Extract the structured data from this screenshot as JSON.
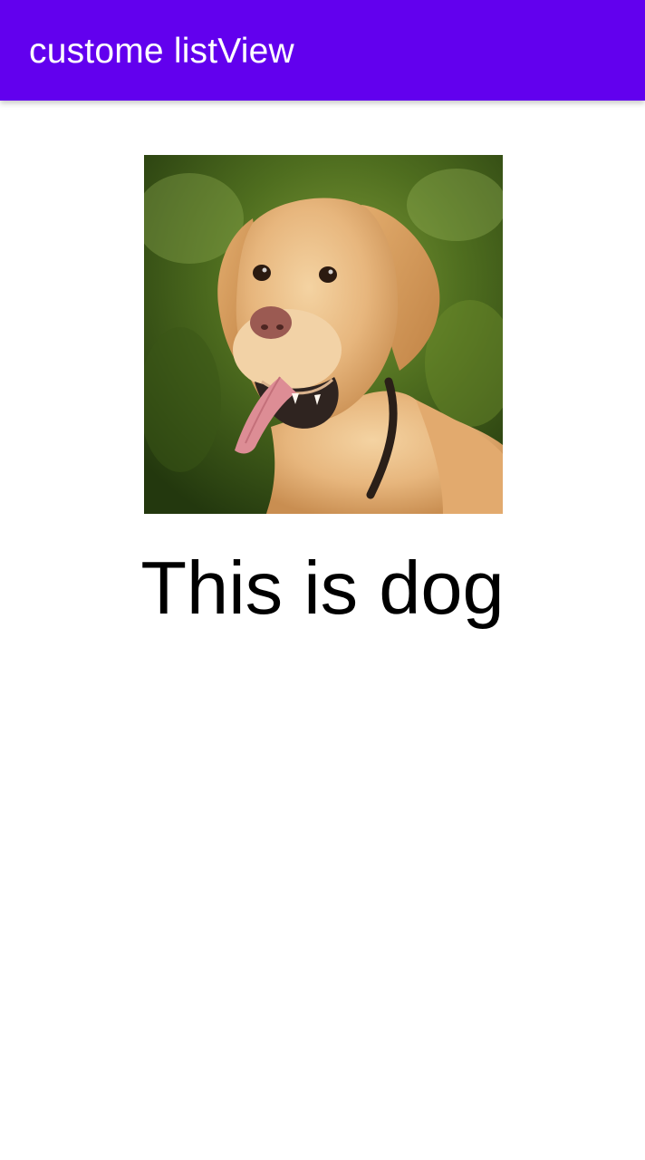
{
  "app_bar": {
    "title": "custome listView",
    "color": "#6200ee"
  },
  "list": {
    "items": [
      {
        "image_icon": "dog-photo",
        "label": "This is dog"
      }
    ]
  }
}
